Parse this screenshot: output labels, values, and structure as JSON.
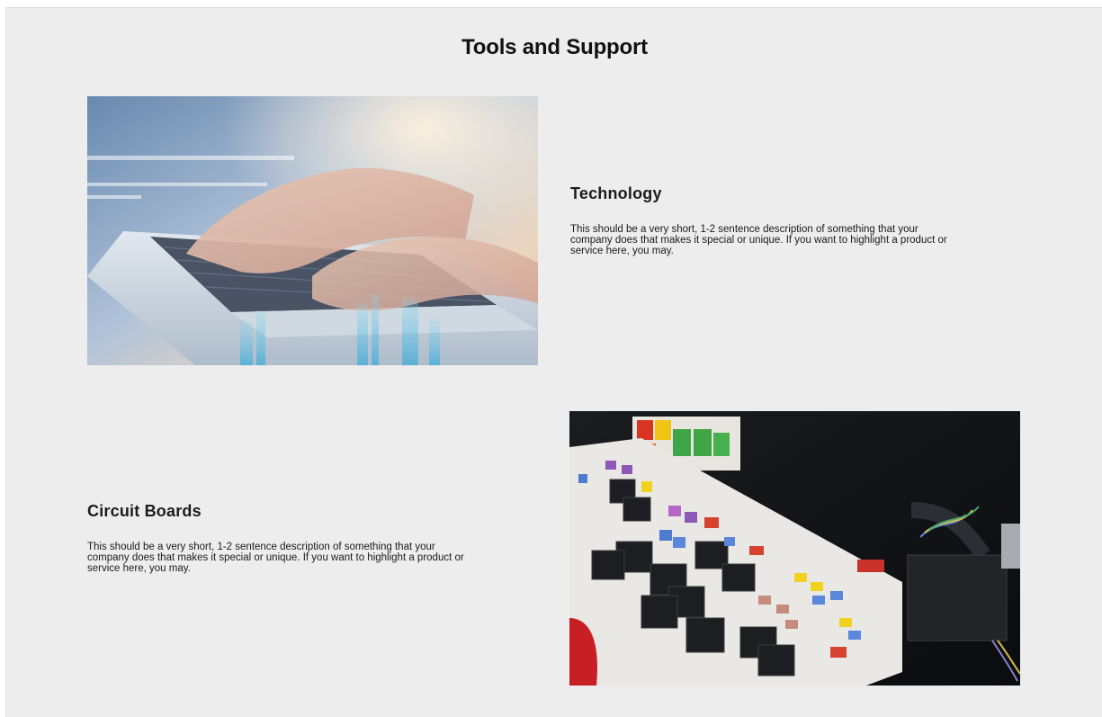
{
  "page": {
    "title": "Tools and Support"
  },
  "features": [
    {
      "heading": "Technology",
      "description": "This should be a very short, 1-2 sentence description of something that your company does that makes it special or unique. If you want to highlight a product or service here, you may.",
      "image": "laptop-typing-photo"
    },
    {
      "heading": "Circuit Boards",
      "description": "This should be a very short, 1-2 sentence description of something that your company does that makes it special or unique. If you want to highlight a product or service here, you may.",
      "image": "fuse-box-photo"
    }
  ],
  "colors": {
    "section_bg": "#ededed",
    "title_text": "#111111",
    "body_text": "#1a1a1a"
  }
}
